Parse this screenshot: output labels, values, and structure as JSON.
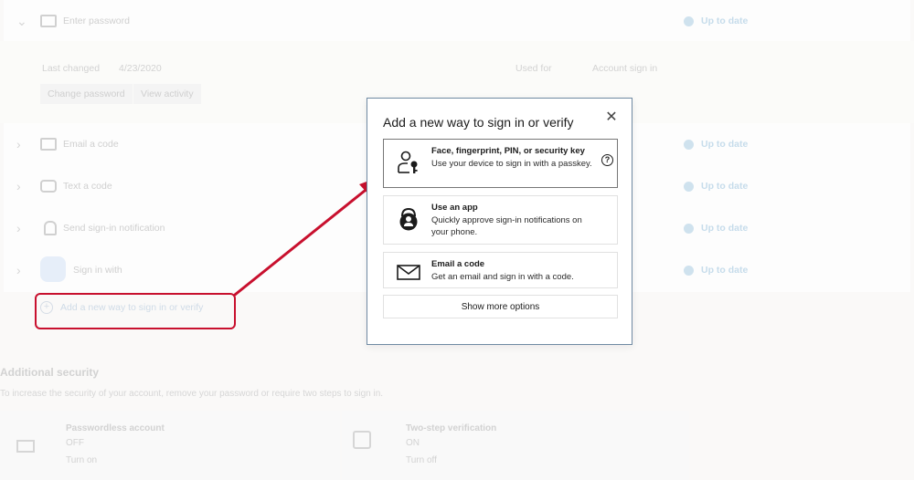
{
  "background": {
    "password_row": {
      "label": "Enter password",
      "status": "Up to date"
    },
    "password_details": {
      "last_changed_label": "Last changed",
      "last_changed_value": "4/23/2020",
      "used_for_label": "Used for",
      "used_for_value": "Account sign in",
      "change_password": "Change password",
      "view_activity": "View activity"
    },
    "methods": [
      {
        "label": "Email a code",
        "status": "Up to date"
      },
      {
        "label": "Text a code",
        "status": "Up to date"
      },
      {
        "label": "Send sign-in notification",
        "status": "Up to date"
      },
      {
        "label": "Sign in with",
        "status": "Up to date"
      }
    ],
    "add_method": "Add a new way to sign in or verify",
    "additional_security": {
      "title": "Additional security",
      "description": "To increase the security of your account, remove your password or require two steps to sign in.",
      "passwordless": {
        "title": "Passwordless account",
        "state": "OFF",
        "action": "Turn on"
      },
      "two_step": {
        "title": "Two-step verification",
        "state": "ON",
        "action": "Turn off"
      }
    }
  },
  "dialog": {
    "title": "Add a new way to sign in or verify",
    "close_icon": "close-icon",
    "options": [
      {
        "title": "Face, fingerprint, PIN, or security key",
        "description": "Use your device to sign in with a passkey.",
        "icon": "person-key-icon",
        "help": "?"
      },
      {
        "title": "Use an app",
        "description": "Quickly approve sign-in notifications on your phone.",
        "icon": "authenticator-app-icon"
      },
      {
        "title": "Email a code",
        "description": "Get an email and sign in with a code.",
        "icon": "envelope-icon"
      }
    ],
    "show_more": "Show more options"
  },
  "colors": {
    "annotation_red": "#c8102e",
    "dialog_border": "#6f8aa3",
    "status_blue": "#c6dceb"
  }
}
